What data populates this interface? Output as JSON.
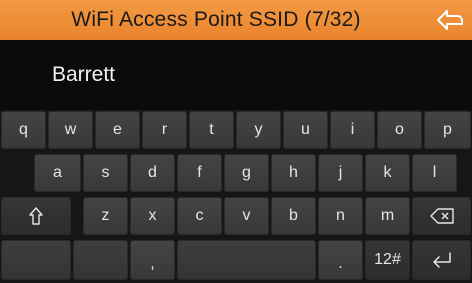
{
  "header": {
    "title": "WiFi Access Point SSID (7/32)",
    "back_icon": "back-arrow-icon",
    "color": "#ef8f37"
  },
  "input": {
    "value": "Barrett"
  },
  "keyboard": {
    "row1": [
      "q",
      "w",
      "e",
      "r",
      "t",
      "y",
      "u",
      "i",
      "o",
      "p"
    ],
    "row2": [
      "a",
      "s",
      "d",
      "f",
      "g",
      "h",
      "j",
      "k",
      "l"
    ],
    "row3": {
      "shift_icon": "shift-arrow-icon",
      "letters": [
        "z",
        "x",
        "c",
        "v",
        "b",
        "n",
        "m"
      ],
      "backspace_icon": "backspace-icon"
    },
    "row4": {
      "comma": ",",
      "period": ".",
      "mode": "12#",
      "enter_icon": "enter-icon"
    }
  }
}
